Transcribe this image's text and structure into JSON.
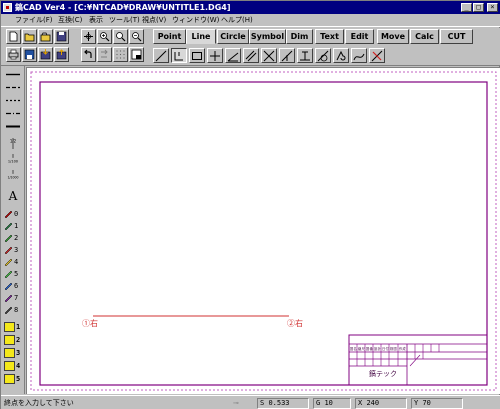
{
  "window": {
    "title": "鎬CAD Ver4 - [C:¥NTCAD¥DRAW¥UNTITLE1.DG4]",
    "minimize_glyph": "_",
    "maximize_glyph": "□",
    "close_glyph": "×"
  },
  "menubar": {
    "items": [
      {
        "label": "ファイル(F)"
      },
      {
        "label": "互換(C)"
      },
      {
        "label": "表示"
      },
      {
        "label": "ツール(T)"
      },
      {
        "label": "視点(V)"
      },
      {
        "label": "ウィンドウ(W)"
      },
      {
        "label": "ヘルプ(H)"
      }
    ]
  },
  "toolbar": {
    "icons": [
      "new-icon",
      "open-icon",
      "folder-icon",
      "save-icon",
      "pan-icon",
      "zoom-in-icon",
      "zoom-window-icon",
      "zoom-out-icon",
      "print-icon",
      "save-disk-icon",
      "import-icon",
      "export-icon",
      "undo-icon",
      "redo-icon",
      "grid-icon",
      "frame-icon"
    ]
  },
  "tabs": [
    {
      "label": "Point",
      "active": false
    },
    {
      "label": "Line",
      "active": true
    },
    {
      "label": "Circle",
      "active": false
    },
    {
      "label": "Symbol",
      "active": false
    },
    {
      "label": "Dim",
      "active": false
    },
    {
      "label": "Text",
      "active": false
    },
    {
      "label": "Edit",
      "active": false
    },
    {
      "label": "Move",
      "active": false
    },
    {
      "label": "Calc",
      "active": false
    },
    {
      "label": "CUT",
      "active": false
    }
  ],
  "line_tools": [
    "line-segment-icon",
    "orthogonal-line-icon",
    "rectangle-icon",
    "cross-line-icon",
    "angle-line-icon",
    "parallel-line-icon",
    "bisector-line-icon",
    "tangent-line-icon",
    "perpendicular-line-icon",
    "arc-tangent-icon",
    "loop-line-icon",
    "curve-line-icon",
    "break-line-icon"
  ],
  "left_panel": {
    "text_tool_label": "A",
    "scale_labels": [
      "1/2",
      "1/100",
      "1/1000"
    ],
    "pens": [
      {
        "num": "0",
        "color": "#c00000"
      },
      {
        "num": "1",
        "color": "#208040"
      },
      {
        "num": "2",
        "color": "#30a030"
      },
      {
        "num": "3",
        "color": "#d02020"
      },
      {
        "num": "4",
        "color": "#e0c020"
      },
      {
        "num": "5",
        "color": "#40c040"
      },
      {
        "num": "6",
        "color": "#2060d0"
      },
      {
        "num": "7",
        "color": "#8020a0"
      },
      {
        "num": "8",
        "color": "#404040"
      }
    ],
    "layers": [
      {
        "num": "1"
      },
      {
        "num": "2"
      },
      {
        "num": "3"
      },
      {
        "num": "4"
      },
      {
        "num": "5"
      }
    ]
  },
  "drawing": {
    "border_color": "#800080",
    "guide_color": "#c060c0",
    "red_line_color": "#d03030",
    "point1_label": "①右",
    "point2_label": "②右",
    "title_block": {
      "header_cells": [
        "図",
        "名",
        "縮",
        "尺",
        "図",
        "番",
        "設",
        "計",
        "日",
        "付",
        "検",
        "図",
        "作",
        "成"
      ],
      "company": "鎬テック"
    }
  },
  "status": {
    "message": "終点を入力して下さい",
    "s_label": "S",
    "s_value": "0.533",
    "g_label": "G",
    "g_value": "10",
    "x_label": "X",
    "x_value": "240",
    "y_label": "Y",
    "y_value": "70"
  }
}
